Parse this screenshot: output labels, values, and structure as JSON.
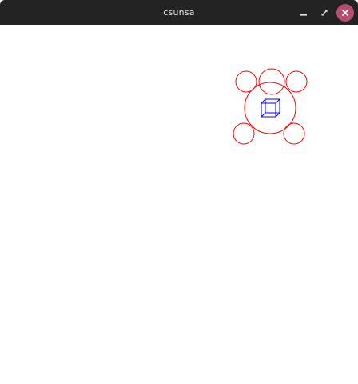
{
  "window": {
    "title": "csunsa",
    "buttons": {
      "minimize_icon": "minimize-icon",
      "maximize_icon": "maximize-icon",
      "close_icon": "close-icon"
    }
  },
  "colors": {
    "titlebar": "#232323",
    "title_text": "#e6e6e6",
    "close_button": "#b84e6f",
    "circle_stroke": "#ff0000",
    "cube_stroke": "#0000ff",
    "canvas_background": "#ffffff"
  }
}
